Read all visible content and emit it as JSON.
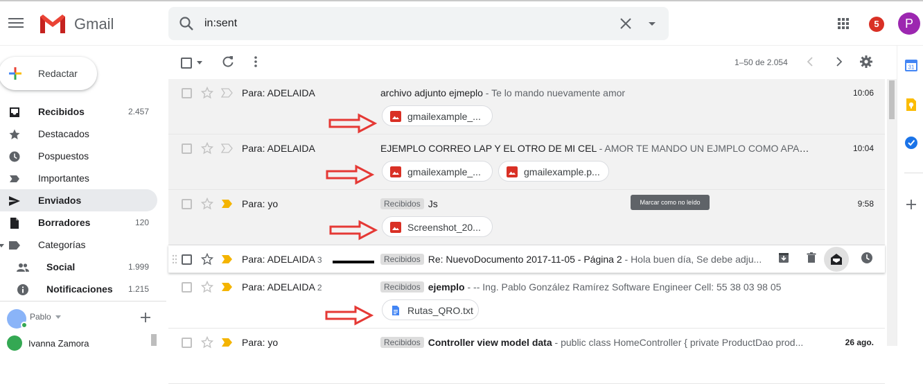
{
  "app": {
    "name": "Gmail"
  },
  "search": {
    "value": "in:sent"
  },
  "header": {
    "notifications": "5",
    "avatar_letter": "P"
  },
  "compose": {
    "label": "Redactar"
  },
  "sidebar": {
    "items": [
      {
        "label": "Recibidos",
        "count": "2.457",
        "bold": true,
        "icon": "inbox-icon"
      },
      {
        "label": "Destacados",
        "count": "",
        "bold": false,
        "icon": "star-icon"
      },
      {
        "label": "Pospuestos",
        "count": "",
        "bold": false,
        "icon": "clock-icon"
      },
      {
        "label": "Importantes",
        "count": "",
        "bold": false,
        "icon": "important-icon"
      },
      {
        "label": "Enviados",
        "count": "",
        "bold": true,
        "icon": "send-icon"
      },
      {
        "label": "Borradores",
        "count": "120",
        "bold": true,
        "icon": "draft-icon"
      },
      {
        "label": "Categorías",
        "count": "",
        "bold": false,
        "icon": "label-icon"
      },
      {
        "label": "Social",
        "count": "1.999",
        "bold": true,
        "icon": "people-icon"
      },
      {
        "label": "Notificaciones",
        "count": "1.215",
        "bold": true,
        "icon": "info-icon"
      }
    ],
    "hangouts_user": "Pablo",
    "contact": "Ivanna Zamora"
  },
  "toolbar": {
    "range": "1–50 de 2.054"
  },
  "emails": [
    {
      "sender": "Para: ADELAIDA",
      "count": "",
      "label": "",
      "subject": "archivo adjunto ejmeplo",
      "snippet": " - Te lo mando nuevamente amor",
      "time": "10:06",
      "attachments": [
        "gmailexample_..."
      ]
    },
    {
      "sender": "Para: ADELAIDA",
      "count": "",
      "label": "",
      "subject": "EJEMPLO CORREO LAP Y EL OTRO DE MI CEL",
      "snippet": " - AMOR TE MANDO UN EJMPLO COMO APAREC...",
      "time": "10:04",
      "attachments": [
        "gmailexample_...",
        "gmailexample.p..."
      ]
    },
    {
      "sender": "Para: yo",
      "count": "",
      "label": "Recibidos",
      "subject": "Js",
      "snippet": "",
      "time": "9:58",
      "attachments": [
        "Screenshot_20..."
      ]
    },
    {
      "sender": "Para: ADELAIDA",
      "count": "3",
      "label": "Recibidos",
      "subject": "Re: NuevoDocumento 2017-11-05 - Página 2",
      "snippet": " - Hola buen día, Se debe adju...",
      "time": "",
      "attachments": []
    },
    {
      "sender": "Para: ADELAIDA",
      "count": "2",
      "label": "Recibidos",
      "subject": "ejemplo",
      "snippet": " - -- Ing. Pablo González Ramírez Software Engineer Cell: 55 38 03 98 05",
      "time": "",
      "attachments": [
        "Rutas_QRO.txt"
      ]
    },
    {
      "sender": "Para: yo",
      "count": "",
      "label": "Recibidos",
      "subject": "Controller view model data",
      "snippet": " - public class HomeController { private ProductDao prod...",
      "time": "26 ago.",
      "attachments": []
    }
  ],
  "tooltip": "Marcar como no leído",
  "colors": {
    "accent_red": "#d93025",
    "arrow_red": "#e53935",
    "important_yellow": "#f4b400",
    "avatar": "#9c27b0"
  }
}
